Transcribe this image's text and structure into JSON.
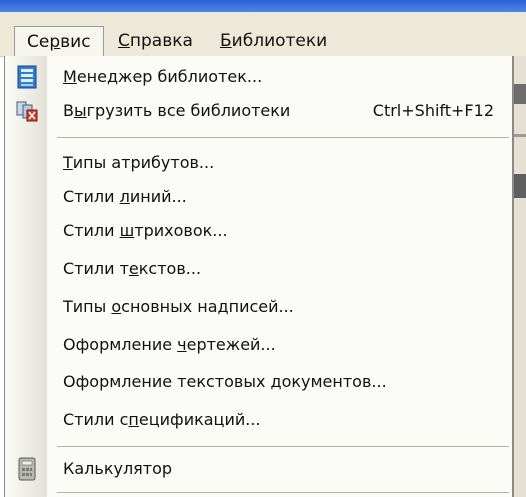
{
  "menubar": {
    "items": [
      {
        "pre": "Се",
        "u": "р",
        "post": "вис",
        "active": true
      },
      {
        "pre": "",
        "u": "С",
        "post": "правка",
        "active": false
      },
      {
        "pre": "",
        "u": "Б",
        "post": "иблиотеки",
        "active": false
      }
    ]
  },
  "menu": {
    "items": [
      {
        "pre": "",
        "u": "М",
        "post": "енеджер библиотек...",
        "icon": "library-manager-icon",
        "shortcut": ""
      },
      {
        "pre": "В",
        "u": "ы",
        "post": "грузить все библиотеки",
        "icon": "unload-libraries-icon",
        "shortcut": "Ctrl+Shift+F12"
      },
      {
        "pre": "",
        "u": "Т",
        "post": "ипы атрибутов...",
        "icon": "",
        "shortcut": ""
      },
      {
        "pre": "Стили ",
        "u": "л",
        "post": "иний...",
        "icon": "",
        "shortcut": ""
      },
      {
        "pre": "Стили ",
        "u": "ш",
        "post": "триховок...",
        "icon": "",
        "shortcut": ""
      },
      {
        "pre": "Стили т",
        "u": "е",
        "post": "кстов...",
        "icon": "",
        "shortcut": ""
      },
      {
        "pre": "Типы ",
        "u": "о",
        "post": "сновных надписей...",
        "icon": "",
        "shortcut": ""
      },
      {
        "pre": "Оформление ",
        "u": "ч",
        "post": "ертежей...",
        "icon": "",
        "shortcut": ""
      },
      {
        "pre": "Оформление текстовых ",
        "u": "д",
        "post": "окументов...",
        "icon": "",
        "shortcut": ""
      },
      {
        "pre": "Стили с",
        "u": "п",
        "post": "ецификаций...",
        "icon": "",
        "shortcut": ""
      },
      {
        "pre": "Калькулятор",
        "u": "",
        "post": "",
        "icon": "calculator-icon",
        "shortcut": ""
      }
    ]
  }
}
